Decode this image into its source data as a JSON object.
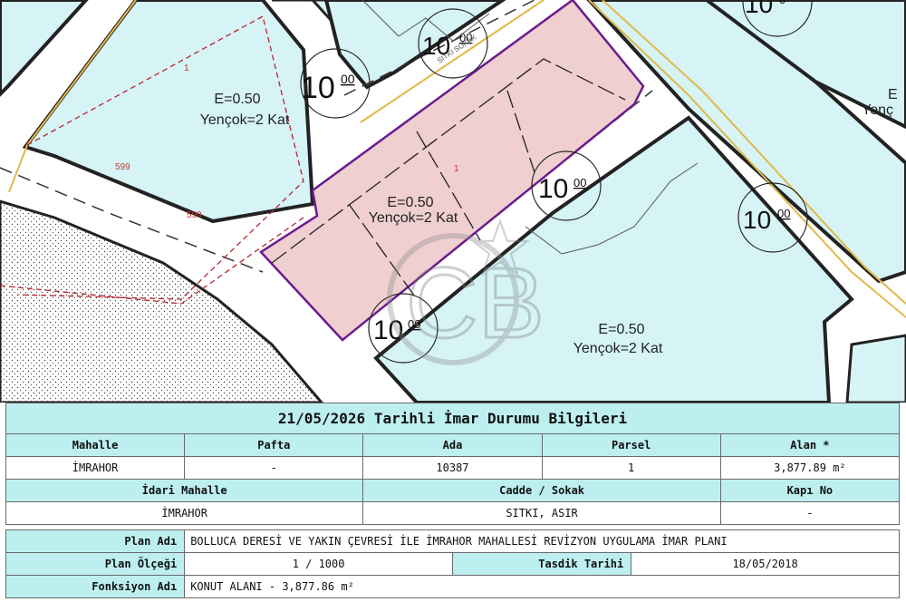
{
  "map": {
    "zone_labels": [
      {
        "density": "E=0.50",
        "height": "Yençok=2 Kat"
      },
      {
        "density": "E=0.50",
        "height": "Yençok=2 Kat"
      },
      {
        "density": "E=0.50",
        "height": "Yençok=2 Kat"
      },
      {
        "density": "E",
        "height": "Yenç"
      }
    ],
    "road_widths": [
      {
        "main": "10",
        "sup": "00"
      },
      {
        "main": "10",
        "sup": "00"
      },
      {
        "main": "10",
        "sup": "00"
      },
      {
        "main": "10",
        "sup": "00"
      },
      {
        "main": "10",
        "sup": "00"
      },
      {
        "main": "10",
        "sup": "0"
      }
    ],
    "parcel_numbers": [
      "1",
      "599",
      "1",
      "599"
    ],
    "street_name": "SITKI SOKAK",
    "watermark": "CB",
    "colors": {
      "block_fill": "#d6f3f6",
      "selected_parcel": "#efcfcf",
      "selected_outline": "#6b1b8f",
      "road_edge": "#e2b84a",
      "cadastre_red": "#b4262c"
    }
  },
  "info": {
    "title": "21/05/2026 Tarihli İmar Durumu Bilgileri",
    "row1_headers": [
      "Mahalle",
      "Pafta",
      "Ada",
      "Parsel",
      "Alan *"
    ],
    "row1_values": [
      "İMRAHOR",
      "-",
      "10387",
      "1",
      "3,877.89 m²"
    ],
    "row2_headers": {
      "idari_mahalle": "İdari Mahalle",
      "cadde_sokak": "Cadde / Sokak",
      "kapi_no": "Kapı No"
    },
    "row2_values": {
      "idari_mahalle": "İMRAHOR",
      "cadde_sokak": "SITKI, ASIR",
      "kapi_no": "-"
    }
  },
  "plan": {
    "plan_adi_label": "Plan Adı",
    "plan_adi_value": "BOLLUCA DERESİ VE YAKIN ÇEVRESİ İLE İMRAHOR MAHALLESİ REVİZYON UYGULAMA İMAR PLANI",
    "plan_olcegi_label": "Plan Ölçeği",
    "plan_olcegi_value": "1 / 1000",
    "tasdik_label": "Tasdik Tarihi",
    "tasdik_value": "18/05/2018",
    "fonksiyon_label": "Fonksiyon Adı",
    "fonksiyon_value": "KONUT ALANI - 3,877.86 m²"
  }
}
